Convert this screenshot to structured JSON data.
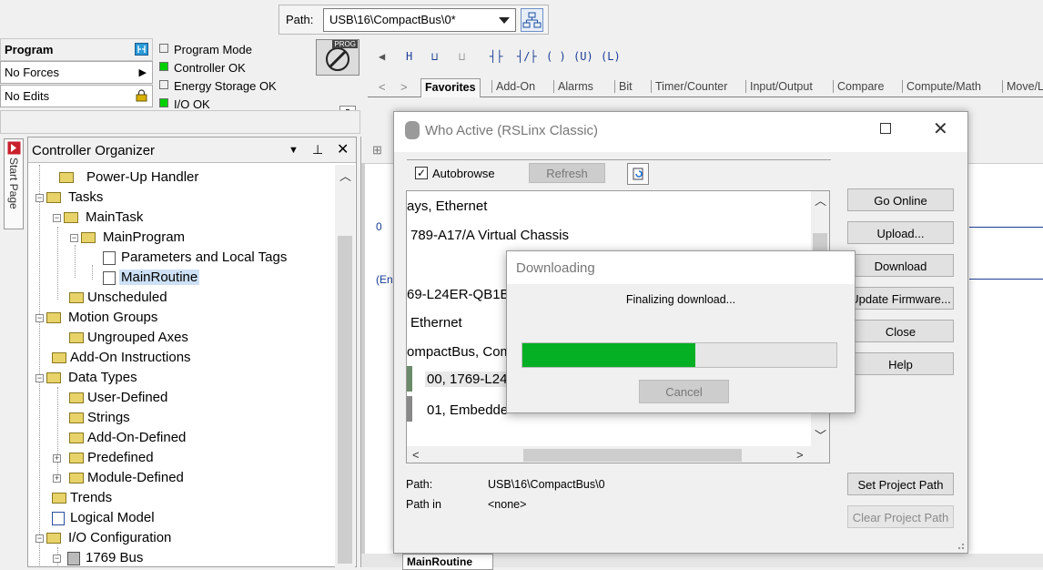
{
  "pathbar": {
    "label": "Path:",
    "value": "USB\\16\\CompactBus\\0*"
  },
  "status": {
    "mode": "Program",
    "forces": "No Forces",
    "edits": "No Edits",
    "lights": [
      {
        "label": "Program Mode",
        "color": "#f0f0f0"
      },
      {
        "label": "Controller OK",
        "color": "#00d000"
      },
      {
        "label": "Energy Storage OK",
        "color": "#f0f0f0"
      },
      {
        "label": "I/O OK",
        "color": "#00d000"
      }
    ],
    "prog_badge": "PROG"
  },
  "toolbar": {
    "instructions": [
      "H",
      "⊔",
      "⊔",
      "┤├",
      "┤/├",
      "( )",
      "(U)",
      "(L)"
    ],
    "tabs": [
      "Favorites",
      "Add-On",
      "Alarms",
      "Bit",
      "Timer/Counter",
      "Input/Output",
      "Compare",
      "Compute/Math",
      "Move/L"
    ]
  },
  "organizer": {
    "title": "Controller Organizer",
    "start_page": "Start Page",
    "tree": [
      "Power-Up Handler",
      "Tasks",
      "MainTask",
      "MainProgram",
      "Parameters and Local Tags",
      "MainRoutine",
      "Unscheduled",
      "Motion Groups",
      "Ungrouped Axes",
      "Add-On Instructions",
      "Data Types",
      "User-Defined",
      "Strings",
      "Add-On-Defined",
      "Predefined",
      "Module-Defined",
      "Trends",
      "Logical Model",
      "I/O Configuration",
      "1769 Bus"
    ]
  },
  "editor": {
    "rung0": "0",
    "end": "(En",
    "bottom_tab": "MainRoutine"
  },
  "who_active": {
    "title": "Who Active (RSLinx Classic)",
    "autobrowse": "Autobrowse",
    "refresh": "Refresh",
    "tree_rows": [
      "ays, Ethernet",
      "789-A17/A Virtual Chassis",
      "69-L24ER-QB1B",
      " Ethernet",
      "ompactBus, Com",
      "00, 1769-L24",
      "01, Embedde"
    ],
    "buttons": [
      "Go Online",
      "Upload...",
      "Download",
      "Update Firmware...",
      "Close",
      "Help"
    ],
    "set_path": "Set Project Path",
    "clear_path": "Clear Project Path",
    "path_label": "Path:",
    "path_value": "USB\\16\\CompactBus\\0",
    "path_in_label": "Path in",
    "path_in_value": "<none>"
  },
  "downloading": {
    "title": "Downloading",
    "message": "Finalizing download...",
    "progress": 0.55,
    "cancel": "Cancel",
    "fill_color": "#06b025"
  }
}
